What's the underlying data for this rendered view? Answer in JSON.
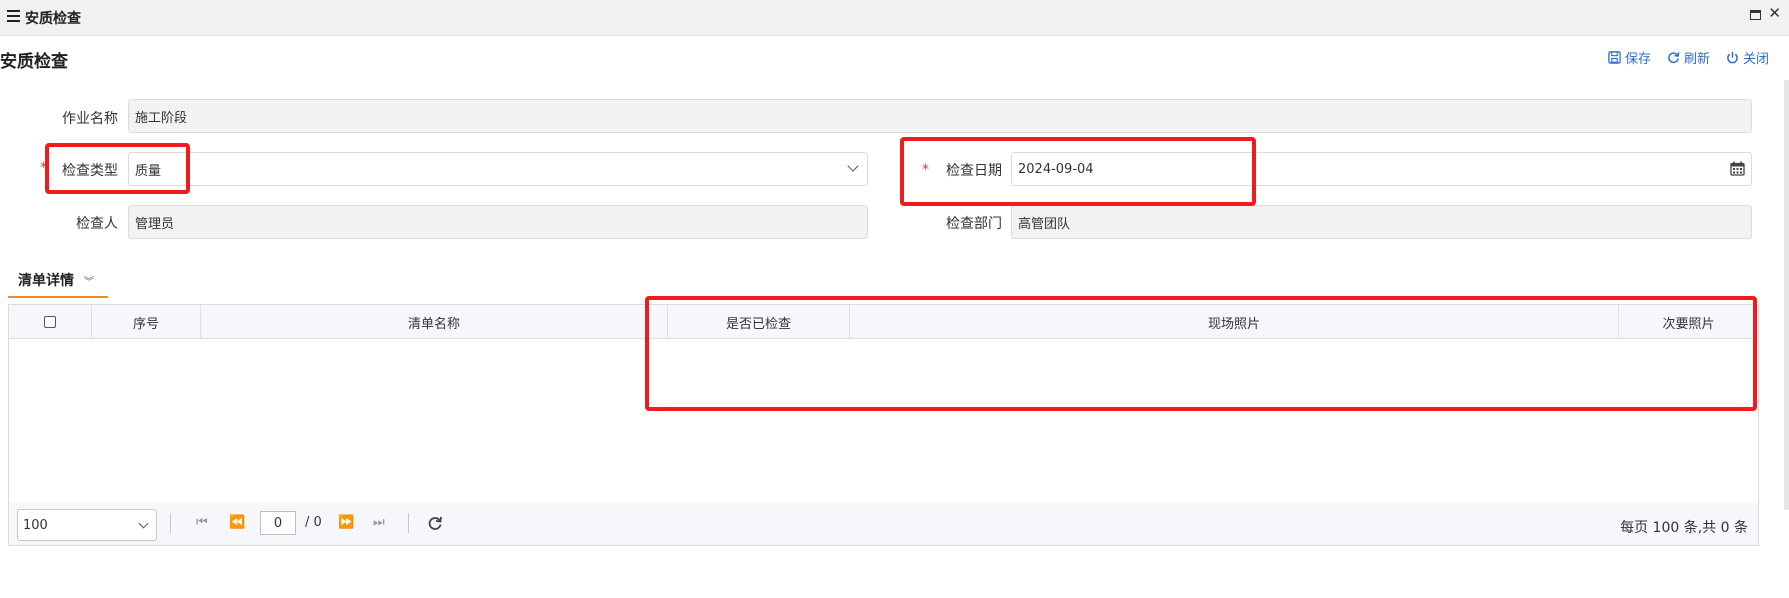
{
  "window": {
    "title": "安质检查"
  },
  "page": {
    "title": "安质检查"
  },
  "actions": {
    "save": "保存",
    "refresh": "刷新",
    "close": "关闭"
  },
  "form": {
    "job_name": {
      "label": "作业名称",
      "value": "施工阶段"
    },
    "inspect_type": {
      "label": "检查类型",
      "value": "质量",
      "required": true
    },
    "inspect_date": {
      "label": "检查日期",
      "value": "2024-09-04",
      "required": true
    },
    "inspector": {
      "label": "检查人",
      "value": "管理员"
    },
    "inspect_dept": {
      "label": "检查部门",
      "value": "高管团队"
    }
  },
  "tab": {
    "label": "清单详情"
  },
  "grid": {
    "columns": [
      "序号",
      "清单名称",
      "是否已检查",
      "现场照片",
      "次要照片"
    ],
    "rows": []
  },
  "pager": {
    "page_size": "100",
    "current_page": "0",
    "total_pages": "/ 0",
    "summary": "每页 100 条,共 0 条"
  },
  "colors": {
    "accent_link": "#2d6ec9",
    "tab_underline": "#f08a1c",
    "annotation": "#ee1c1c",
    "required": "#e23b2b"
  }
}
